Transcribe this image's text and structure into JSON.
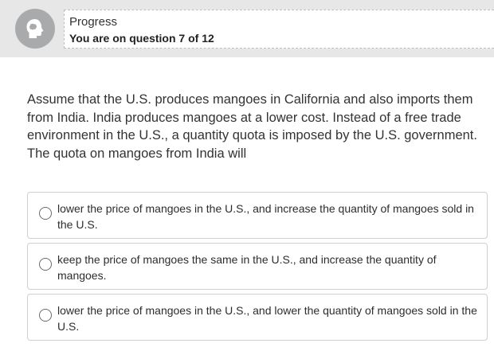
{
  "progress": {
    "label": "Progress",
    "text": "You are on question 7 of 12"
  },
  "avatar": {
    "icon": "brain-head-icon"
  },
  "question": {
    "text": "Assume that the U.S. produces mangoes in California and also imports them from India. India produces mangoes at a lower cost. Instead of a free trade environment in the U.S., a quantity quota is imposed by the U.S. government. The quota on mangoes from India will"
  },
  "options": [
    {
      "text": "lower the price of mangoes in the U.S., and increase the quantity of mangoes sold in the U.S."
    },
    {
      "text": "keep the price of mangoes the same in the U.S., and increase the quantity of mangoes."
    },
    {
      "text": "lower the price of mangoes in the U.S., and lower the quantity of mangoes sold in the U.S."
    }
  ]
}
